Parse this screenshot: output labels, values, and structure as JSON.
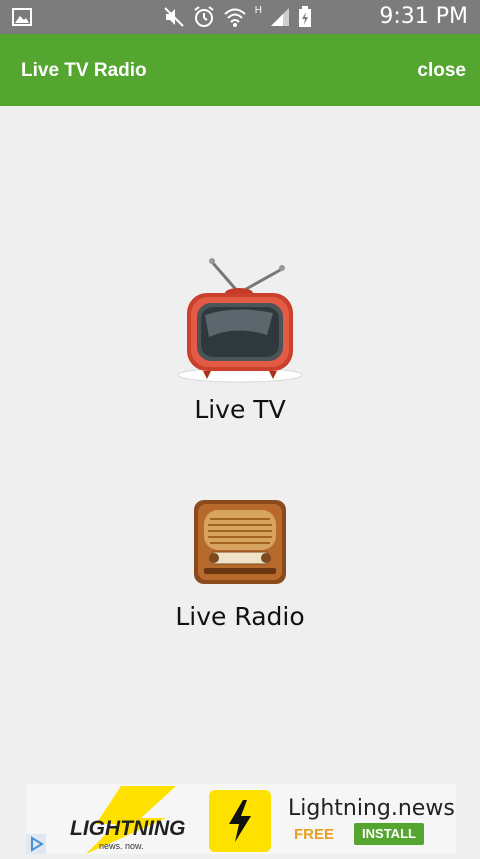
{
  "status_bar": {
    "time": "9:31 PM",
    "icons": [
      "gallery-icon",
      "mute-icon",
      "alarm-icon",
      "wifi-icon",
      "network-type-icon",
      "signal-icon",
      "battery-charging-icon"
    ],
    "network_type": "H"
  },
  "app_bar": {
    "title": "Live TV Radio",
    "close_label": "close",
    "color": "#55a630"
  },
  "menu": {
    "items": [
      {
        "label": "Live TV",
        "icon": "tv-icon"
      },
      {
        "label": "Live Radio",
        "icon": "radio-icon"
      }
    ]
  },
  "ad": {
    "logo_text": "LIGHTNING",
    "logo_tagline": "news. now.",
    "app_name": "Lightning.news",
    "price": "FREE",
    "install_label": "INSTALL",
    "icon": "lightning-bolt-icon"
  },
  "colors": {
    "accent": "#55a630",
    "background": "#efefef",
    "status_bar": "#7c7c7c"
  }
}
